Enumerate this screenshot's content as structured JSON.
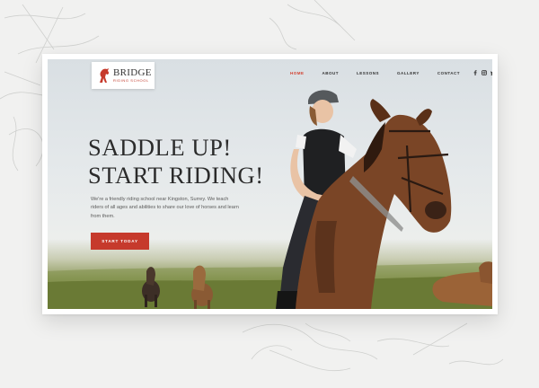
{
  "logo": {
    "name": "BRIDGE",
    "tagline": "RIDING SCHOOL"
  },
  "nav": {
    "items": [
      {
        "label": "HOME",
        "active": true
      },
      {
        "label": "ABOUT",
        "active": false
      },
      {
        "label": "LESSONS",
        "active": false
      },
      {
        "label": "GALLERY",
        "active": false
      },
      {
        "label": "CONTACT",
        "active": false
      }
    ],
    "social": [
      "facebook-icon",
      "instagram-icon",
      "twitter-icon"
    ]
  },
  "hero": {
    "headline_line1": "SADDLE UP!",
    "headline_line2": "START RIDING!",
    "intro": "We're a friendly riding school near Kingston, Surrey. We teach riders of all ages and abilities to share our love of horses and learn from them.",
    "cta_label": "START TODAY"
  },
  "colors": {
    "accent": "#c63a2c",
    "active_nav": "#d2402f",
    "headline": "#2b2b2b"
  }
}
